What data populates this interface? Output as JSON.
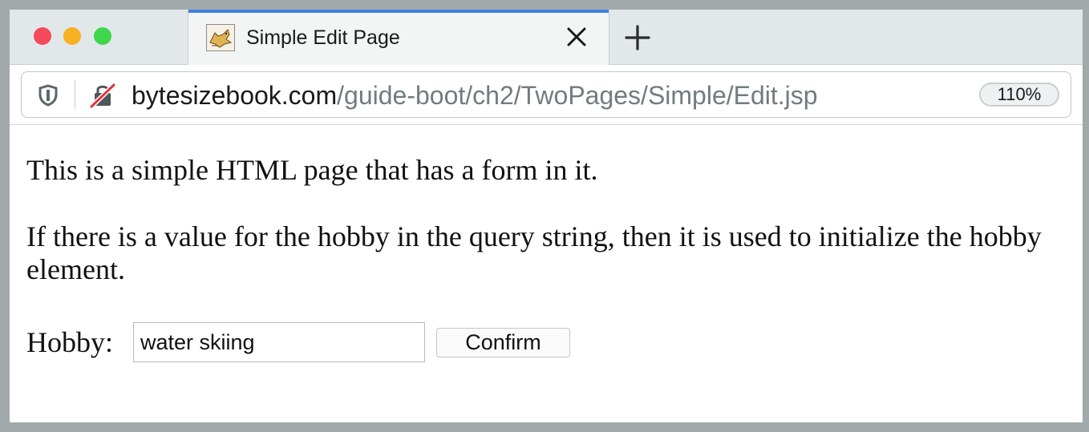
{
  "browser": {
    "tab": {
      "title": "Simple Edit Page",
      "favicon": "tomcat-icon"
    },
    "url": {
      "host": "bytesizebook.com",
      "path": "/guide-boot/ch2/TwoPages/Simple/Edit.jsp"
    },
    "zoom": "110%",
    "colors": {
      "accent": "#3f7fe3",
      "close": "#f5485a",
      "minimize": "#f8b122",
      "maximize": "#3fd74b"
    }
  },
  "page": {
    "paragraph1": "This is a simple HTML page that has a form in it.",
    "paragraph2": "If there is a value for the hobby in the query string, then it is used to initialize the hobby element.",
    "form": {
      "hobby_label": "Hobby:",
      "hobby_value": "water skiing",
      "confirm_label": "Confirm"
    }
  }
}
